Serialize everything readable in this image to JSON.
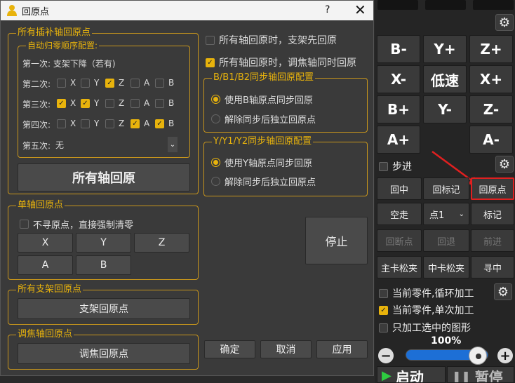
{
  "dialog": {
    "title": "回原点",
    "help": "?",
    "close": "✕",
    "all_interp": {
      "legend": "所有插补轴回原点",
      "order_legend": "自动归零顺序配置:",
      "first_label": "第一次: 支架下降（若有)",
      "axes": [
        "X",
        "Y",
        "Z",
        "A",
        "B"
      ],
      "rows": [
        {
          "label": "第二次:",
          "checked": [
            false,
            false,
            true,
            false,
            false
          ]
        },
        {
          "label": "第三次:",
          "checked": [
            true,
            true,
            false,
            false,
            false
          ]
        },
        {
          "label": "第四次:",
          "checked": [
            false,
            false,
            false,
            true,
            true
          ]
        }
      ],
      "fifth_label": "第五次:",
      "fifth_value": "无",
      "all_home_button": "所有轴回原"
    },
    "options": {
      "bracket_first": "所有轴回原时，支架先回原",
      "focus_same": "所有轴回原时，调焦轴同时回原"
    },
    "bsync": {
      "legend": "B/B1/B2同步轴回原配置",
      "opt1": "使用B轴原点同步回原",
      "opt2": "解除同步后独立回原点"
    },
    "ysync": {
      "legend": "Y/Y1/Y2同步轴回原配置",
      "opt1": "使用Y轴原点同步回原",
      "opt2": "解除同步后独立回原点"
    },
    "single": {
      "legend": "单轴回原点",
      "force_zero": "不寻原点，直接强制清零",
      "buttons": [
        "X",
        "Y",
        "Z",
        "A",
        "B"
      ]
    },
    "bracket": {
      "legend": "所有支架回原点",
      "button": "支架回原点"
    },
    "focus": {
      "legend": "调焦轴回原点",
      "button": "调焦回原点"
    },
    "stop": "停止",
    "ok": "确定",
    "cancel": "取消",
    "apply": "应用"
  },
  "machine": {
    "jog": [
      "B-",
      "Y+",
      "Z+",
      "X-",
      "低速",
      "X+",
      "B+",
      "Y-",
      "Z-",
      "A+",
      "A-"
    ],
    "step": "步进",
    "row1": [
      "回中",
      "回标记",
      "回原点"
    ],
    "idle": "空走",
    "point": "点1",
    "mark": "标记",
    "row3": [
      "回断点",
      "回退",
      "前进"
    ],
    "row4": [
      "主卡松夹",
      "中卡松夹",
      "寻中"
    ],
    "opt_loop": "当前零件,循环加工",
    "opt_single": "当前零件,单次加工",
    "opt_selected": "只加工选中的图形",
    "speed": "100%",
    "start": "启动",
    "pause": "暂停",
    "gear_icon": "⚙",
    "accent": "#e8b30c",
    "highlight": "#e02020"
  }
}
